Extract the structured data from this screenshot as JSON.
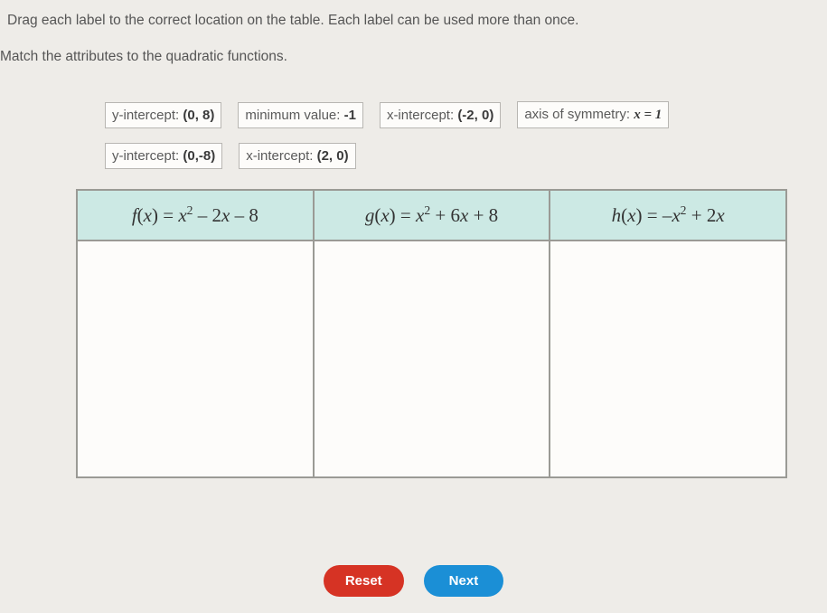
{
  "instructions": {
    "line1": "Drag each label to the correct location on the table. Each label can be used more than once.",
    "line2": "Match the attributes to the quadratic functions."
  },
  "labels": {
    "row1": [
      {
        "prefix": "y-intercept: ",
        "value": "(0, 8)"
      },
      {
        "prefix": "minimum value: ",
        "value": "-1"
      },
      {
        "prefix": "x-intercept: ",
        "value": "(-2, 0)"
      },
      {
        "prefix": "axis of symmetry: ",
        "value": "x = 1",
        "italic_var": true
      }
    ],
    "row2": [
      {
        "prefix": "y-intercept: ",
        "value": "(0,-8)"
      },
      {
        "prefix": "x-intercept: ",
        "value": "(2, 0)"
      }
    ]
  },
  "table": {
    "headers": [
      {
        "name": "f",
        "body": "x² – 2x – 8"
      },
      {
        "name": "g",
        "body": "x² + 6x + 8"
      },
      {
        "name": "h",
        "body": "–x² + 2x"
      }
    ]
  },
  "buttons": {
    "reset": "Reset",
    "next": "Next"
  }
}
